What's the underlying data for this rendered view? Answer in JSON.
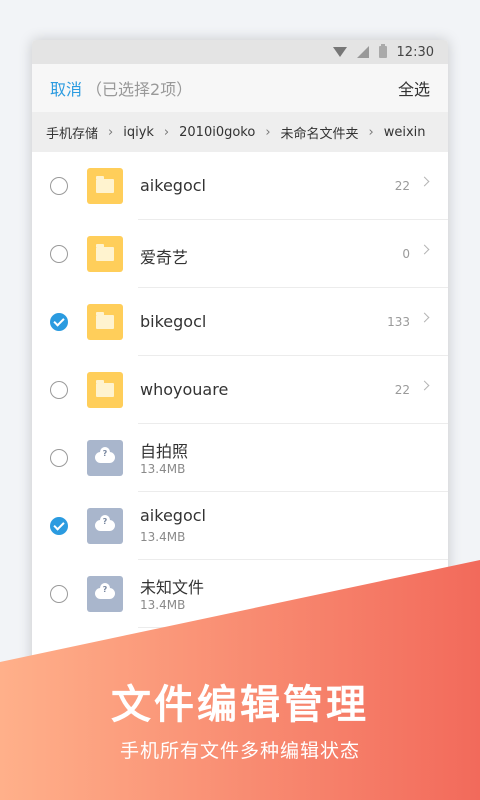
{
  "status": {
    "time": "12:30"
  },
  "topbar": {
    "cancel": "取消",
    "selected": "（已选择2项）",
    "select_all": "全选"
  },
  "breadcrumb": [
    "手机存储",
    "iqiyk",
    "2010i0goko",
    "未命名文件夹",
    "weixin"
  ],
  "items": [
    {
      "type": "folder",
      "name": "aikegocl",
      "count": "22",
      "checked": false
    },
    {
      "type": "folder",
      "name": "爱奇艺",
      "count": "0",
      "checked": false
    },
    {
      "type": "folder",
      "name": "bikegocl",
      "count": "133",
      "checked": true
    },
    {
      "type": "folder",
      "name": "whoyouare",
      "count": "22",
      "checked": false
    },
    {
      "type": "file",
      "name": "自拍照",
      "size": "13.4MB",
      "checked": false
    },
    {
      "type": "file",
      "name": "aikegocl",
      "size": "13.4MB",
      "checked": true
    },
    {
      "type": "file",
      "name": "未知文件",
      "size": "13.4MB",
      "checked": false
    }
  ],
  "banner": {
    "title": "文件编辑管理",
    "subtitle": "手机所有文件多种编辑状态"
  },
  "colors": {
    "accent": "#2b9be0",
    "folder": "#ffce5a",
    "cloud_file": "#a9b6cc",
    "banner_from": "#ffb08a",
    "banner_to": "#f26a5b"
  }
}
